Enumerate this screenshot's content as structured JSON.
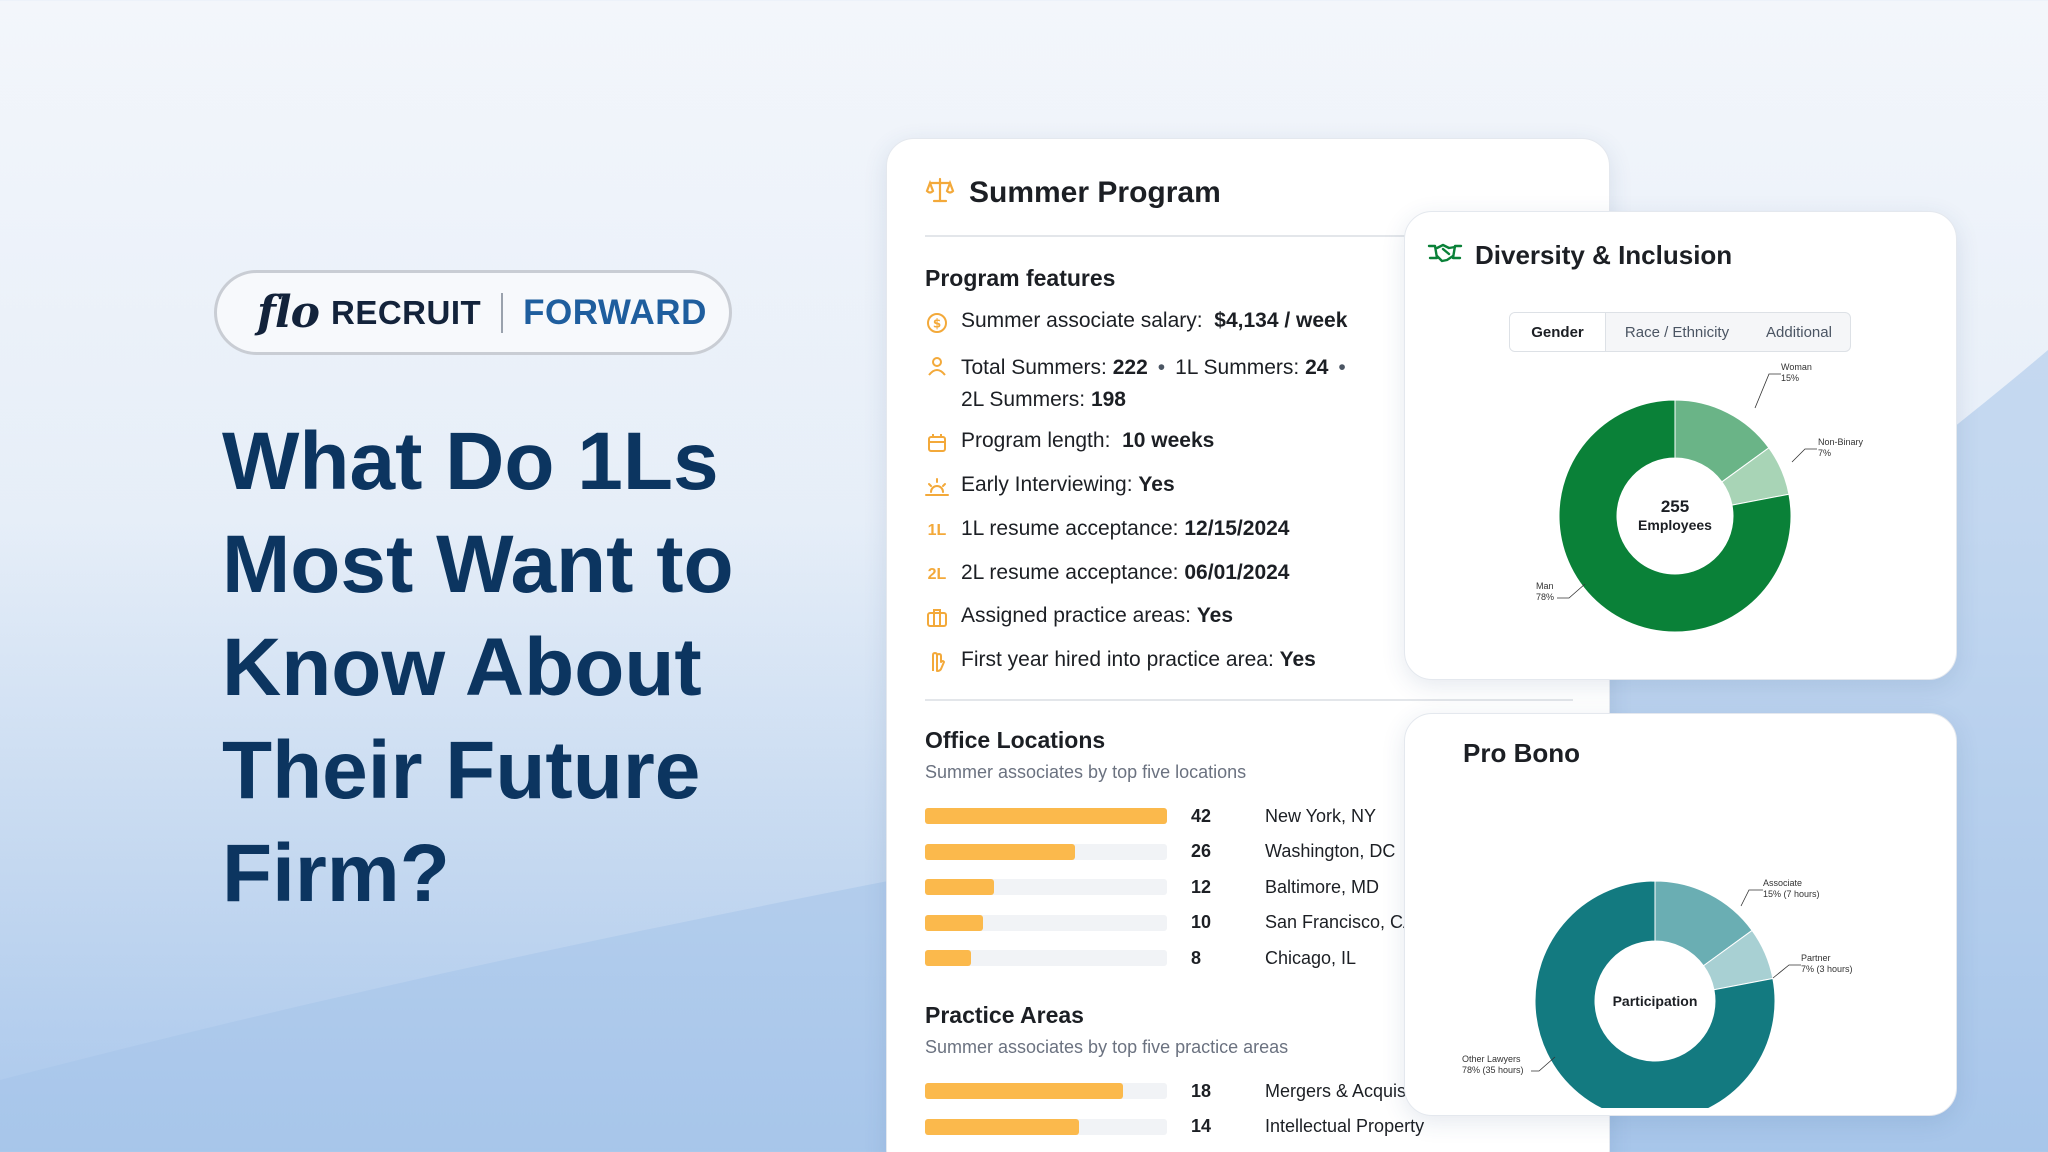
{
  "brand": {
    "logo_script": "flo",
    "logo_word": "RECRUIT",
    "tagline": "FORWARD"
  },
  "headline": "What Do 1Ls Most Want to Know About Their Future Firm?",
  "summer_program": {
    "title": "Summer Program",
    "features_title": "Program features",
    "features": {
      "salary_label": "Summer associate salary:",
      "salary_value": "$4,134 / week",
      "total_label": "Total Summers:",
      "total_value": "222",
      "l1_label": "1L Summers:",
      "l1_value": "24",
      "l2_label": "2L Summers:",
      "l2_value": "198",
      "length_label": "Program length:",
      "length_value": "10 weeks",
      "early_label": "Early Interviewing:",
      "early_value": "Yes",
      "r1_icon": "1L",
      "r1_label": "1L resume acceptance:",
      "r1_value": "12/15/2024",
      "r2_icon": "2L",
      "r2_label": "2L resume acceptance:",
      "r2_value": "06/01/2024",
      "assigned_label": "Assigned practice areas:",
      "assigned_value": "Yes",
      "firstyear_label": "First year hired into practice area:",
      "firstyear_value": "Yes"
    },
    "offices": {
      "title": "Office Locations",
      "subtitle": "Summer associates by top five locations",
      "rows": [
        {
          "value": 42,
          "label": "New York, NY"
        },
        {
          "value": 26,
          "label": "Washington, DC"
        },
        {
          "value": 12,
          "label": "Baltimore, MD"
        },
        {
          "value": 10,
          "label": "San Francisco, CA"
        },
        {
          "value": 8,
          "label": "Chicago, IL"
        }
      ],
      "max": 42
    },
    "practice": {
      "title": "Practice Areas",
      "subtitle": "Summer associates by top five practice areas",
      "rows": [
        {
          "value": 18,
          "label": "Mergers & Acquisitions"
        },
        {
          "value": 14,
          "label": "Intellectual Property"
        }
      ],
      "max": 22
    }
  },
  "diversity": {
    "title": "Diversity & Inclusion",
    "tabs": [
      "Gender",
      "Race / Ethnicity",
      "Additional"
    ],
    "active_tab": "Gender",
    "center_number": "255",
    "center_label": "Employees",
    "colors": {
      "man": "#0a8138",
      "woman": "#6ab487",
      "nonbinary": "#a8d4b6"
    },
    "labels": {
      "man_name": "Man",
      "man_pct": "78%",
      "woman_name": "Woman",
      "woman_pct": "15%",
      "nb_name": "Non-Binary",
      "nb_pct": "7%"
    }
  },
  "pro_bono": {
    "title": "Pro Bono",
    "center_label": "Participation",
    "colors": {
      "other": "#137a80",
      "associate": "#6aaeb3",
      "partner": "#a8d0d3"
    },
    "labels": {
      "assoc_name": "Associate",
      "assoc_val": "15% (7 hours)",
      "partner_name": "Partner",
      "partner_val": "7% (3 hours)",
      "other_name": "Other Lawyers",
      "other_val": "78% (35 hours)"
    }
  },
  "chart_data": [
    {
      "type": "bar",
      "title": "Office Locations",
      "subtitle": "Summer associates by top five locations",
      "categories": [
        "New York, NY",
        "Washington, DC",
        "Baltimore, MD",
        "San Francisco, CA",
        "Chicago, IL"
      ],
      "values": [
        42,
        26,
        12,
        10,
        8
      ]
    },
    {
      "type": "bar",
      "title": "Practice Areas",
      "subtitle": "Summer associates by top five practice areas",
      "categories": [
        "Mergers & Acquisitions",
        "Intellectual Property"
      ],
      "values": [
        18,
        14
      ]
    },
    {
      "type": "pie",
      "title": "Diversity & Inclusion",
      "categories": [
        "Man",
        "Woman",
        "Non-Binary"
      ],
      "values": [
        78,
        15,
        7
      ]
    },
    {
      "type": "pie",
      "title": "Pro Bono",
      "categories": [
        "Other Lawyers",
        "Associate",
        "Partner"
      ],
      "values": [
        78,
        15,
        7
      ]
    }
  ]
}
